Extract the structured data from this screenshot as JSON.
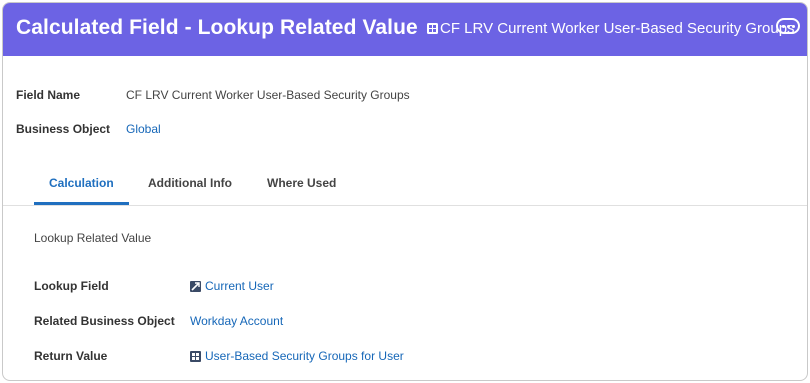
{
  "header": {
    "title": "Calculated Field - Lookup Related Value",
    "object_name": "CF LRV Current Worker User-Based Security Groups",
    "object_icon": "grid-icon",
    "more_icon": "ellipsis-icon",
    "background_color": "#6c63e4"
  },
  "fields": {
    "field_name_label": "Field Name",
    "field_name_value": "CF LRV Current Worker User-Based Security Groups",
    "business_object_label": "Business Object",
    "business_object_value": "Global"
  },
  "tabs": [
    {
      "label": "Calculation",
      "active": true
    },
    {
      "label": "Additional Info",
      "active": false
    },
    {
      "label": "Where Used",
      "active": false
    }
  ],
  "calculation": {
    "section_title": "Lookup Related Value",
    "rows": [
      {
        "label": "Lookup Field",
        "value": "Current User",
        "icon": "field-icon"
      },
      {
        "label": "Related Business Object",
        "value": "Workday Account",
        "icon": ""
      },
      {
        "label": "Return Value",
        "value": "User-Based Security Groups for User",
        "icon": "grid-icon"
      }
    ]
  },
  "colors": {
    "accent": "#1f6fbf",
    "link": "#1667b8"
  }
}
